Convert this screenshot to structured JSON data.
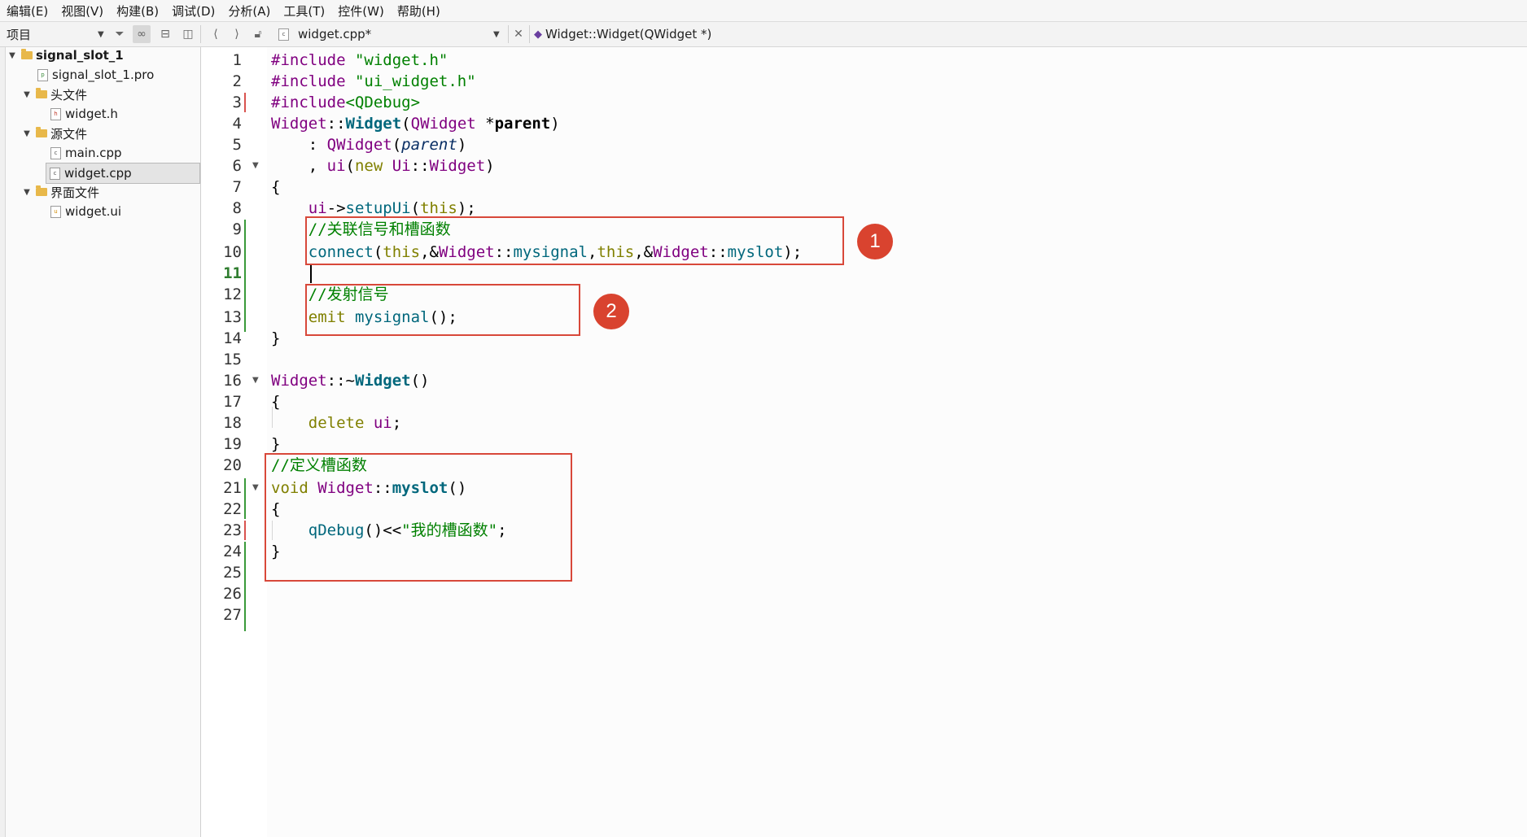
{
  "menu": [
    "编辑(E)",
    "视图(V)",
    "构建(B)",
    "调试(D)",
    "分析(A)",
    "工具(T)",
    "控件(W)",
    "帮助(H)"
  ],
  "toolbar": {
    "project_selector": "项目",
    "file_tab": "widget.cpp*",
    "symbol_selector": "Widget::Widget(QWidget *)"
  },
  "tree": {
    "project": "signal_slot_1",
    "pro_file": "signal_slot_1.pro",
    "headers_folder": "头文件",
    "header_file": "widget.h",
    "sources_folder": "源文件",
    "main_file": "main.cpp",
    "widget_file": "widget.cpp",
    "forms_folder": "界面文件",
    "ui_file": "widget.ui"
  },
  "editor": {
    "current_line": 11,
    "lines": [
      {
        "n": "1"
      },
      {
        "n": "2"
      },
      {
        "n": "3"
      },
      {
        "n": "4"
      },
      {
        "n": "5"
      },
      {
        "n": "6"
      },
      {
        "n": "7"
      },
      {
        "n": "8"
      },
      {
        "n": "9"
      },
      {
        "n": "10"
      },
      {
        "n": "11"
      },
      {
        "n": "12"
      },
      {
        "n": "13"
      },
      {
        "n": "14"
      },
      {
        "n": "15"
      },
      {
        "n": "16"
      },
      {
        "n": "17"
      },
      {
        "n": "18"
      },
      {
        "n": "19"
      },
      {
        "n": "20"
      },
      {
        "n": "21"
      },
      {
        "n": "22"
      },
      {
        "n": "23"
      },
      {
        "n": "24"
      },
      {
        "n": "25"
      },
      {
        "n": "26"
      },
      {
        "n": "27"
      }
    ],
    "code": {
      "l1_kw": "#include ",
      "l1_str": "\"widget.h\"",
      "l2_kw": "#include ",
      "l2_str": "\"ui_widget.h\"",
      "l3_kw": "#include",
      "l3_str": "<QDebug>",
      "l4_cls": "Widget",
      "l4_sep": "::",
      "l4_fn": "Widget",
      "l4_open": "(",
      "l4_ty": "QWidget",
      "l4_sp": " *",
      "l4_arg": "parent",
      "l4_close": ")",
      "l5_pre": "    : ",
      "l5_ty": "QWidget",
      "l5_open": "(",
      "l5_arg": "parent",
      "l5_close": ")",
      "l6_pre": "    , ",
      "l6_ui": "ui",
      "l6_open": "(",
      "l6_new": "new ",
      "l6_ns": "Ui",
      "l6_sep": "::",
      "l6_cls": "Widget",
      "l6_close": ")",
      "l7": "{",
      "l8_pre": "    ",
      "l8_ui": "ui",
      "l8_arrow": "->",
      "l8_fn": "setupUi",
      "l8_open": "(",
      "l8_this": "this",
      "l8_close": ");",
      "l9_pre": "    ",
      "l9_cm": "//关联信号和槽函数",
      "l10_pre": "    ",
      "l10_fn": "connect",
      "l10_open": "(",
      "l10_this1": "this",
      "l10_amp1": ",&",
      "l10_cls1": "Widget",
      "l10_sep1": "::",
      "l10_sig": "mysignal",
      "l10_comma": ",",
      "l10_this2": "this",
      "l10_amp2": ",&",
      "l10_cls2": "Widget",
      "l10_sep2": "::",
      "l10_slot": "myslot",
      "l10_close": ");",
      "l12_pre": "    ",
      "l12_cm": "//发射信号",
      "l13_pre": "    ",
      "l13_kw": "emit ",
      "l13_fn": "mysignal",
      "l13_close": "();",
      "l14": "}",
      "l16_cls": "Widget",
      "l16_sep": "::~",
      "l16_fn": "Widget",
      "l16_close": "()",
      "l17": "{",
      "l18_pre": "    ",
      "l18_kw": "delete ",
      "l18_ui": "ui",
      "l18_end": ";",
      "l19": "}",
      "l20_cm": "//定义槽函数",
      "l21_kw": "void ",
      "l21_cls": "Widget",
      "l21_sep": "::",
      "l21_fn": "myslot",
      "l21_close": "()",
      "l22": "{",
      "l23_pre": "    ",
      "l23_fn": "qDebug",
      "l23_mid": "()<<",
      "l23_str": "\"我的槽函数\"",
      "l23_end": ";",
      "l24": "}"
    }
  },
  "annotations": {
    "badge1": "1",
    "badge2": "2"
  },
  "colors": {
    "annotation_red": "#d8483a",
    "badge_red": "#d9432f",
    "keyword": "#808000",
    "type": "#800080",
    "string": "#008000",
    "function": "#00677c"
  }
}
